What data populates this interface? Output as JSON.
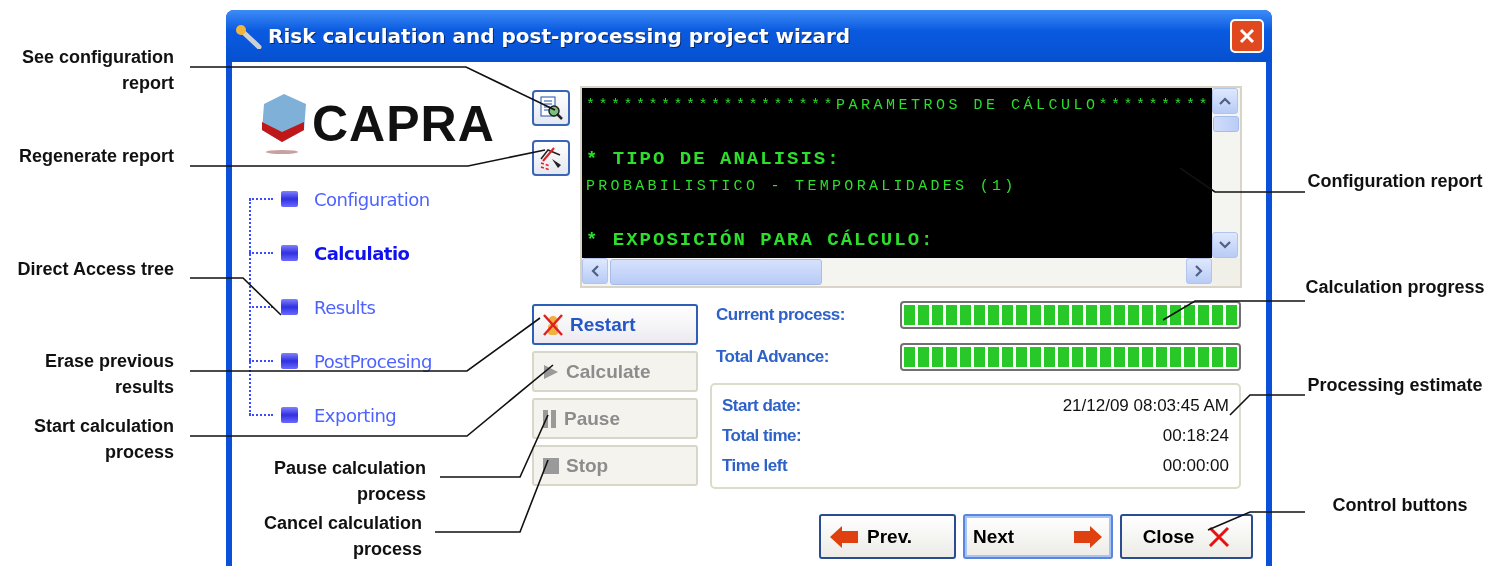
{
  "window": {
    "title": "Risk calculation and post-processing project wizard"
  },
  "logo": {
    "text": "CAPRA"
  },
  "tree": [
    {
      "label": "Configuration",
      "selected": false
    },
    {
      "label": "Calculatio",
      "selected": true
    },
    {
      "label": "Results",
      "selected": false
    },
    {
      "label": "PostProcesing",
      "selected": false
    },
    {
      "label": "Exporting",
      "selected": false
    }
  ],
  "console_lines": [
    {
      "kind": "banner",
      "text": "********************PARAMETROS DE CÁLCULO*********"
    },
    {
      "kind": "heading",
      "text": "* TIPO DE ANALISIS:"
    },
    {
      "kind": "text",
      "text": "PROBABILISTICO - TEMPORALIDADES (1)"
    },
    {
      "kind": "heading",
      "text": "* EXPOSICIÓN PARA CÁLCULO:"
    }
  ],
  "actions": [
    {
      "kind": "restart",
      "label": "Restart",
      "disabled": false
    },
    {
      "kind": "calculate",
      "label": "Calculate",
      "disabled": true
    },
    {
      "kind": "pause",
      "label": "Pause",
      "disabled": true
    },
    {
      "kind": "stop",
      "label": "Stop",
      "disabled": true
    }
  ],
  "progress": [
    {
      "label": "Current process:",
      "level": 1
    },
    {
      "label": "Total Advance:",
      "level": 1
    }
  ],
  "estimate": [
    {
      "label": "Start date:",
      "value": "21/12/09 08:03:45 AM"
    },
    {
      "label": "Total time:",
      "value": "00:18:24"
    },
    {
      "label": "Time left",
      "value": "00:00:00"
    }
  ],
  "nav_buttons": [
    {
      "kind": "prev",
      "label": "Prev.",
      "default": false
    },
    {
      "kind": "next",
      "label": "Next",
      "default": true
    },
    {
      "kind": "close",
      "label": "Close",
      "default": false
    }
  ],
  "annotations": [
    "See configuration report",
    "Regenerate report",
    "Direct Access tree",
    "Erase previous results",
    "Start calculation process",
    "Pause calculation process",
    "Cancel calculation process",
    "Configuration report",
    "Calculation progress",
    "Processing estimate",
    "Control buttons"
  ]
}
